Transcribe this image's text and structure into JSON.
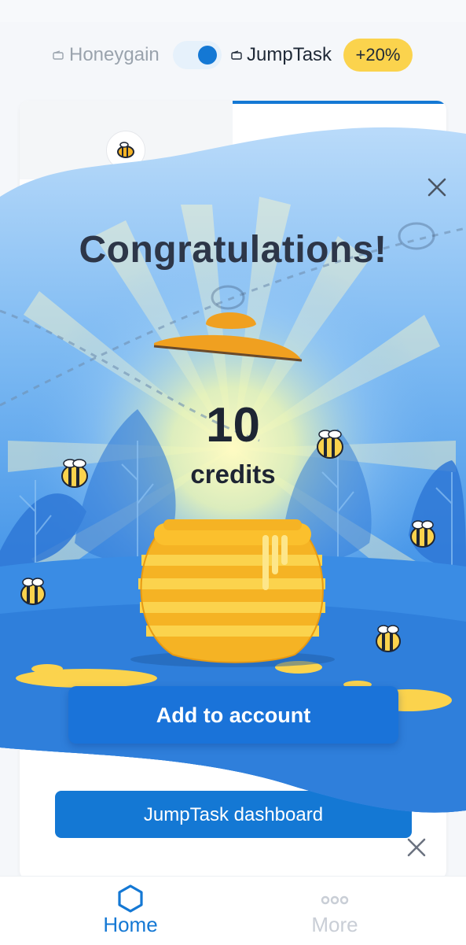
{
  "switcher": {
    "left_label": "Honeygain",
    "right_label": "JumpTask",
    "bonus": "+20%"
  },
  "card": {
    "dashboard_button": "JumpTask dashboard"
  },
  "modal": {
    "title": "Congratulations!",
    "amount": "10",
    "unit": "credits",
    "action_button": "Add to account"
  },
  "nav": {
    "home_label": "Home",
    "more_label": "More"
  },
  "colors": {
    "accent": "#1478d4",
    "bonus": "#fbd34d",
    "modal_blue": "#3d8fe0",
    "honey": "#f5b324"
  }
}
